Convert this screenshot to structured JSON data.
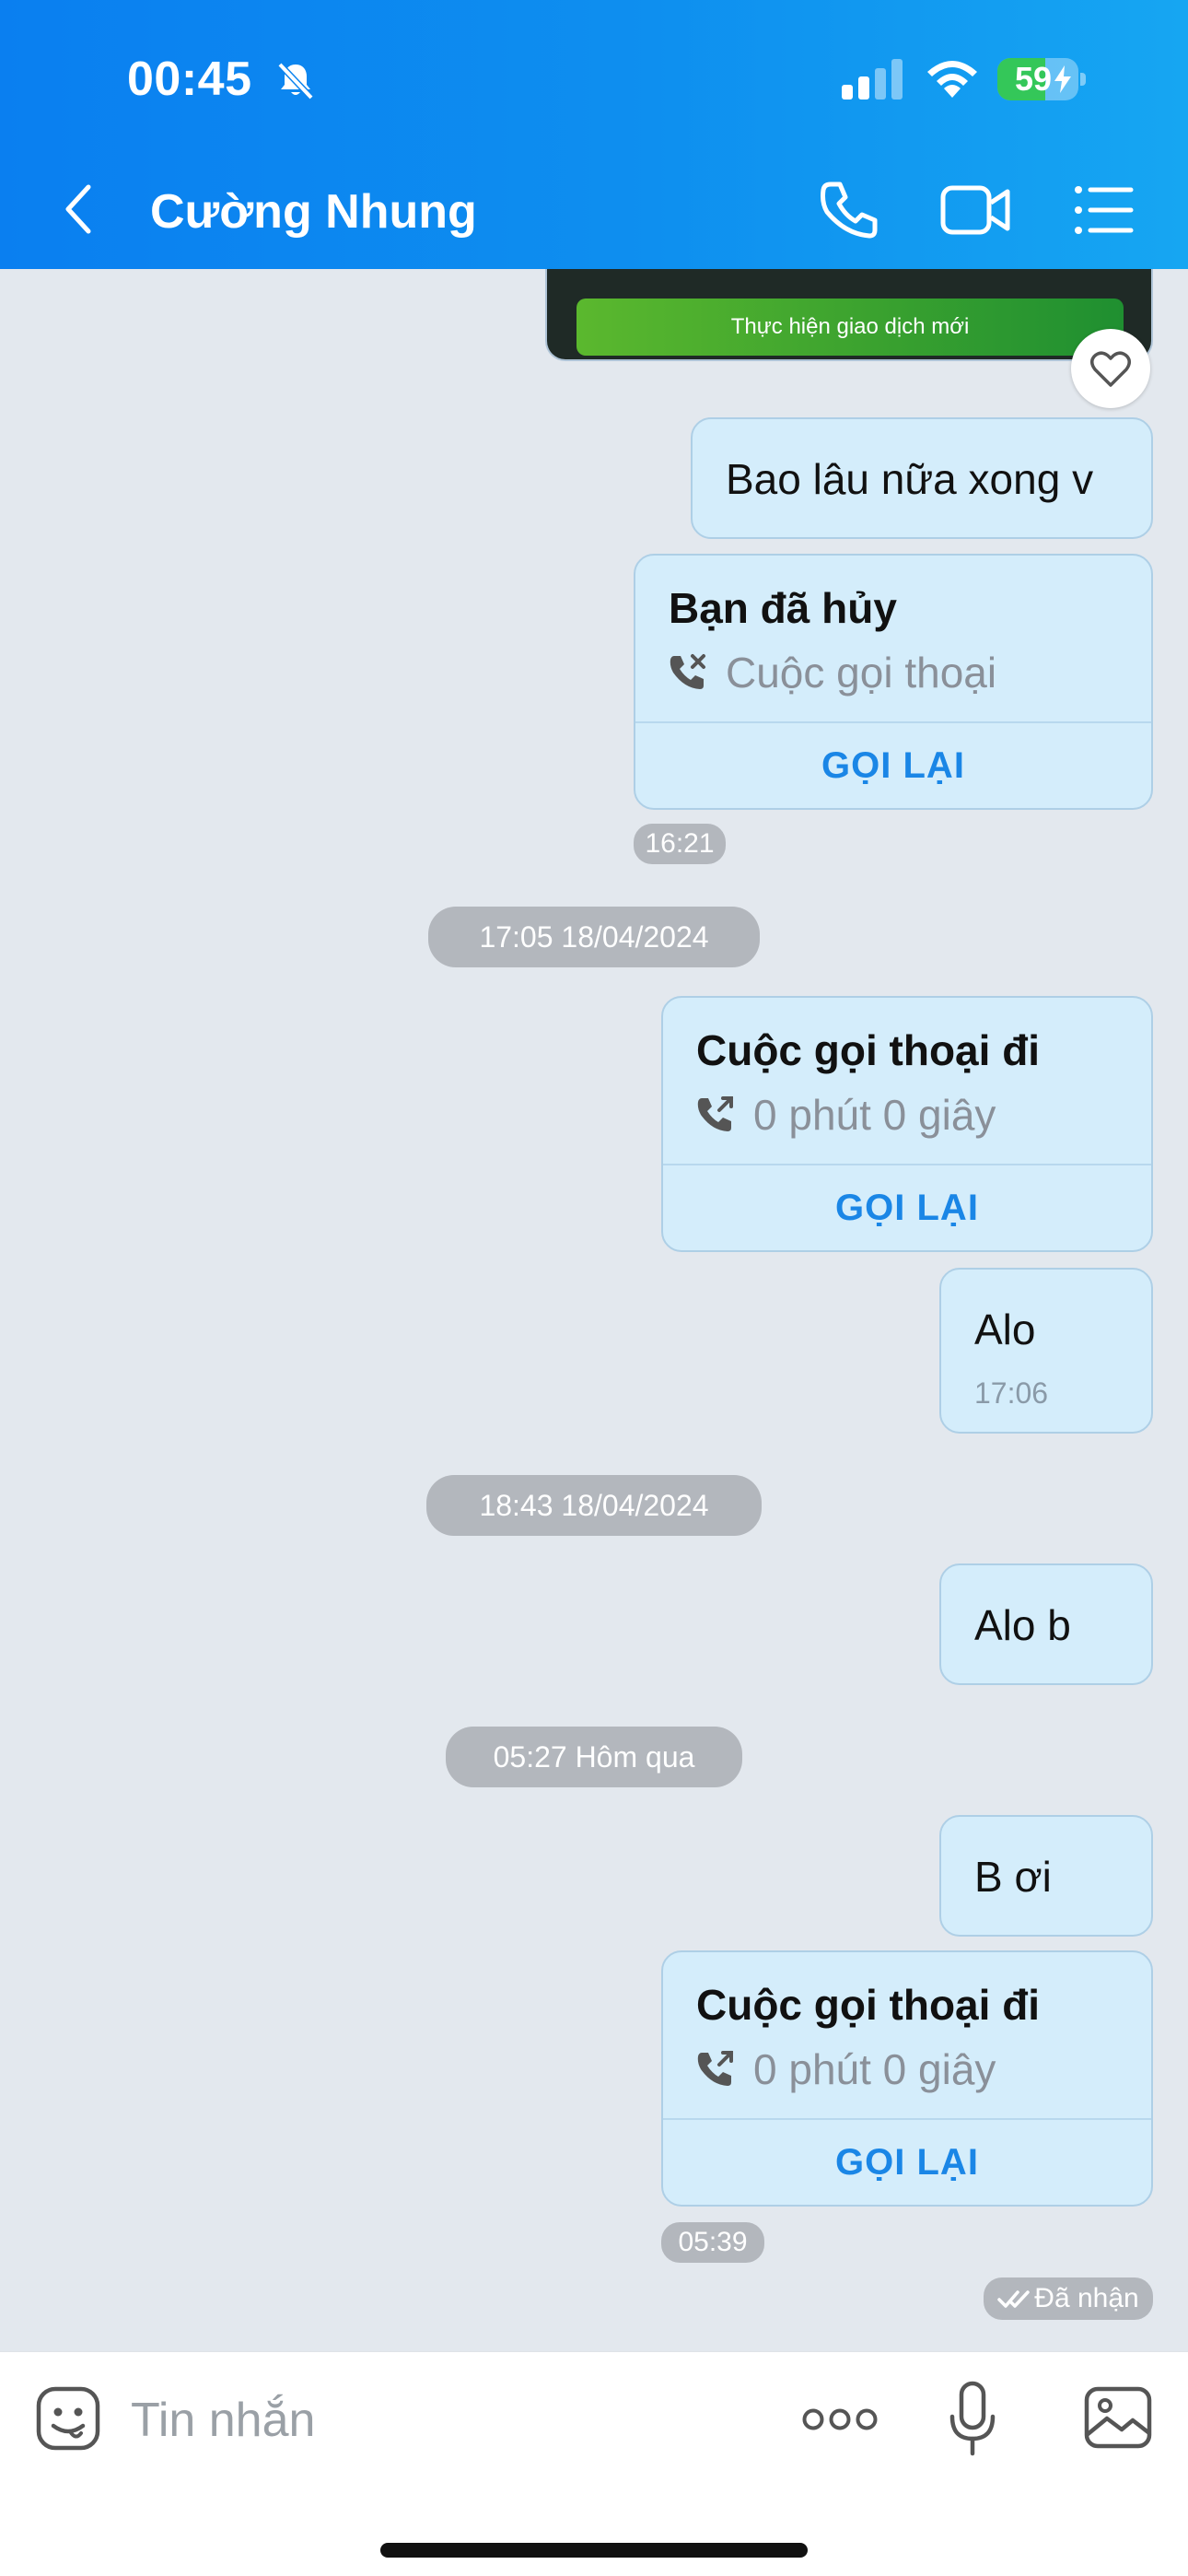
{
  "status_bar": {
    "time": "00:45",
    "battery": "59",
    "battery_level": 0.59
  },
  "header": {
    "title": "Cường Nhung"
  },
  "messages": {
    "image_button": "Thực hiện giao dịch mới",
    "msg1": "Bao lâu nữa xong v",
    "call1": {
      "title": "Bạn đã hủy",
      "sub": "Cuộc gọi thoại",
      "action": "GỌI LẠI"
    },
    "time1": "16:21",
    "sep1": "17:05 18/04/2024",
    "call2": {
      "title": "Cuộc gọi thoại đi",
      "sub": "0 phút 0 giây",
      "action": "GỌI LẠI"
    },
    "msg2": "Alo",
    "msg2_time": "17:06",
    "sep2": "18:43 18/04/2024",
    "msg3": "Alo b",
    "sep3": "05:27 Hôm qua",
    "msg4": "B ơi",
    "call3": {
      "title": "Cuộc gọi thoại đi",
      "sub": "0 phút 0 giây",
      "action": "GỌI LẠI"
    },
    "time2": "05:39",
    "status": "Đã nhận"
  },
  "input": {
    "placeholder": "Tin nhắn"
  },
  "colors": {
    "header_start": "#0a7ff0",
    "header_end": "#16a6f2",
    "bubble": "#d4edfb",
    "action_blue": "#1a86e6",
    "background": "#e3e8ee"
  }
}
